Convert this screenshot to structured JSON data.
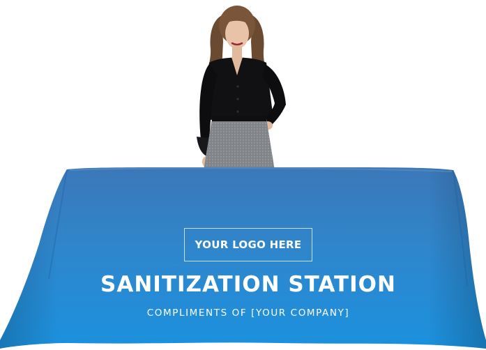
{
  "logo_placeholder": "YOUR LOGO HERE",
  "headline": "SANITIZATION STATION",
  "subline": "COMPLIMENTS OF [YOUR COMPANY]",
  "colors": {
    "background": "#ffffff",
    "tablecloth_top": "#3d7fbe",
    "tablecloth_bottom": "#1a8fd9",
    "text": "#ffffff"
  }
}
